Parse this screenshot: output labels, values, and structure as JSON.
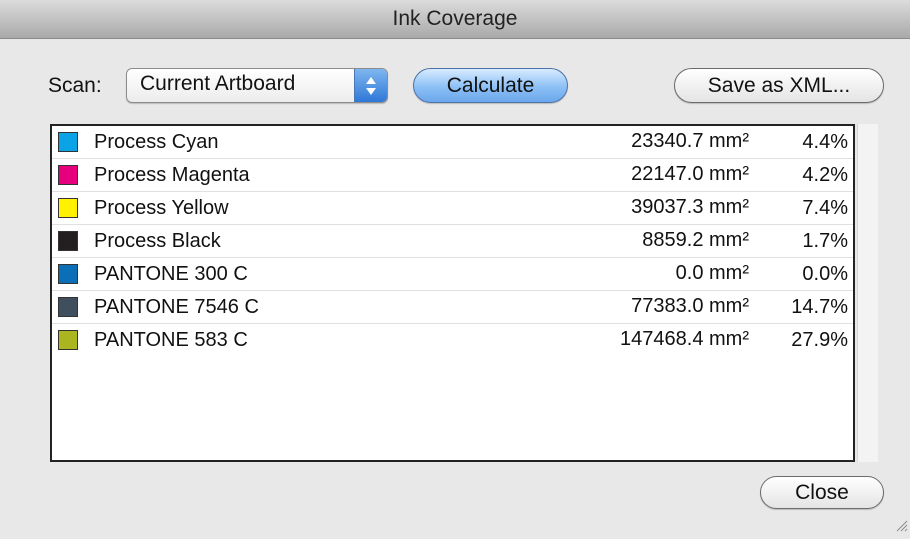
{
  "window": {
    "title": "Ink Coverage"
  },
  "toolbar": {
    "scan_label": "Scan:",
    "scan_value": "Current Artboard",
    "calculate_label": "Calculate",
    "save_label": "Save as XML..."
  },
  "inks": [
    {
      "name": "Process Cyan",
      "area": "23340.7 mm²",
      "percent": "4.4%",
      "color": "#0aa3e6"
    },
    {
      "name": "Process Magenta",
      "area": "22147.0 mm²",
      "percent": "4.2%",
      "color": "#e6007e"
    },
    {
      "name": "Process Yellow",
      "area": "39037.3 mm²",
      "percent": "7.4%",
      "color": "#fff100"
    },
    {
      "name": "Process Black",
      "area": "8859.2 mm²",
      "percent": "1.7%",
      "color": "#231f20"
    },
    {
      "name": "PANTONE 300 C",
      "area": "0.0 mm²",
      "percent": "0.0%",
      "color": "#0a6fb7"
    },
    {
      "name": "PANTONE 7546 C",
      "area": "77383.0 mm²",
      "percent": "14.7%",
      "color": "#3f4f5e"
    },
    {
      "name": "PANTONE 583 C",
      "area": "147468.4 mm²",
      "percent": "27.9%",
      "color": "#aab520"
    }
  ],
  "footer": {
    "close_label": "Close"
  },
  "icons": {
    "popup": "up-down-arrows-icon",
    "resize": "resize-grip-icon"
  }
}
